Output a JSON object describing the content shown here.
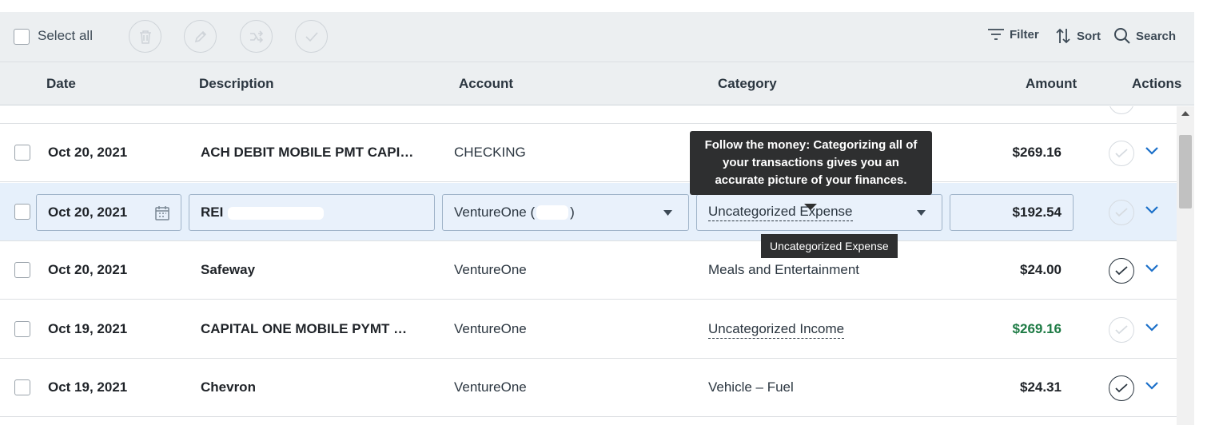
{
  "toolbar": {
    "select_all": "Select all",
    "filter": "Filter",
    "sort": "Sort",
    "search": "Search",
    "bulk_icons": [
      "trash-icon",
      "pencil-icon",
      "merge-icon",
      "check-icon"
    ]
  },
  "columns": {
    "date": "Date",
    "description": "Description",
    "account": "Account",
    "category": "Category",
    "amount": "Amount",
    "actions": "Actions"
  },
  "rows": [
    {
      "date": "Oct 20, 2021",
      "description": "ACH DEBIT MOBILE PMT CAPI…",
      "account": "CHECKING",
      "category": "",
      "amount": "$269.16",
      "reviewed": false
    },
    {
      "date": "Oct 20, 2021",
      "description": "REI",
      "account": "VentureOne (",
      "account_suffix": ")",
      "category": "Uncategorized Expense",
      "amount": "$192.54",
      "reviewed": false,
      "editing": true
    },
    {
      "date": "Oct 20, 2021",
      "description": "Safeway",
      "account": "VentureOne",
      "category": "Meals and Entertainment",
      "amount": "$24.00",
      "reviewed": true
    },
    {
      "date": "Oct 19, 2021",
      "description": "CAPITAL ONE MOBILE PYMT …",
      "account": "VentureOne",
      "category": "Uncategorized Income",
      "amount": "$269.16",
      "reviewed": false,
      "income": true
    },
    {
      "date": "Oct 19, 2021",
      "description": "Chevron",
      "account": "VentureOne",
      "category": "Vehicle – Fuel",
      "amount": "$24.31",
      "reviewed": true
    }
  ],
  "tooltips": {
    "category_hint": "Follow the money: Categorizing all of your transactions gives you an accurate picture of your finances.",
    "category_value": "Uncategorized Expense"
  },
  "colors": {
    "income": "#1e7b45",
    "accent": "#1a6fc9",
    "editing_row": "#e6f0fb"
  }
}
